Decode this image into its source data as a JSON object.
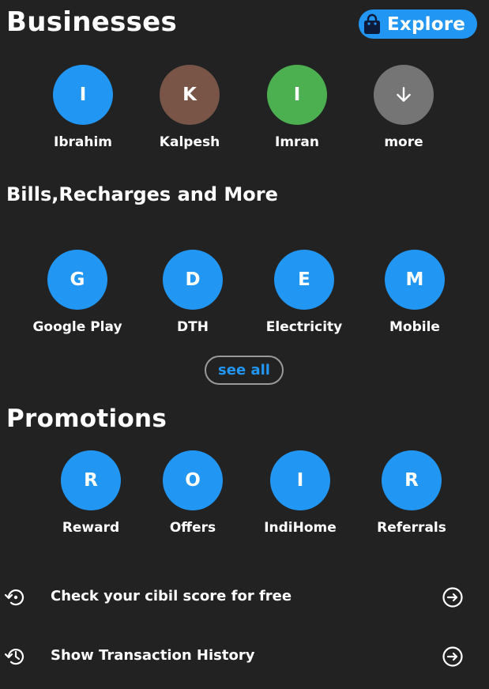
{
  "businesses": {
    "title": "Businesses",
    "explore_label": "Explore",
    "items": [
      {
        "initial": "I",
        "label": "Ibrahim",
        "color": "#2196f3"
      },
      {
        "initial": "K",
        "label": "Kalpesh",
        "color": "#795548"
      },
      {
        "initial": "I",
        "label": "Imran",
        "color": "#4caf50"
      },
      {
        "icon": "arrow-down-icon",
        "label": "more",
        "color": "#757575"
      }
    ]
  },
  "bills": {
    "title": "Bills,Recharges and More",
    "items": [
      {
        "initial": "G",
        "label": "Google Play",
        "color": "#2196f3"
      },
      {
        "initial": "D",
        "label": "DTH",
        "color": "#2196f3"
      },
      {
        "initial": "E",
        "label": "Electricity",
        "color": "#2196f3"
      },
      {
        "initial": "M",
        "label": "Mobile",
        "color": "#2196f3"
      }
    ],
    "see_all_label": "see all"
  },
  "promotions": {
    "title": "Promotions",
    "items": [
      {
        "initial": "R",
        "label": "Reward",
        "color": "#2196f3"
      },
      {
        "initial": "O",
        "label": "Offers",
        "color": "#2196f3"
      },
      {
        "initial": "I",
        "label": "IndiHome",
        "color": "#2196f3"
      },
      {
        "initial": "R",
        "label": "Referrals",
        "color": "#2196f3"
      }
    ]
  },
  "actions": [
    {
      "icon": "restore-icon",
      "label": "Check your cibil score for free",
      "arrow_icon": "arrow-circle-right-icon"
    },
    {
      "icon": "history-icon",
      "label": "Show Transaction History",
      "arrow_icon": "arrow-circle-right-icon"
    }
  ],
  "colors": {
    "background": "#222222",
    "accent": "#2196f3",
    "text": "#ffffff"
  }
}
